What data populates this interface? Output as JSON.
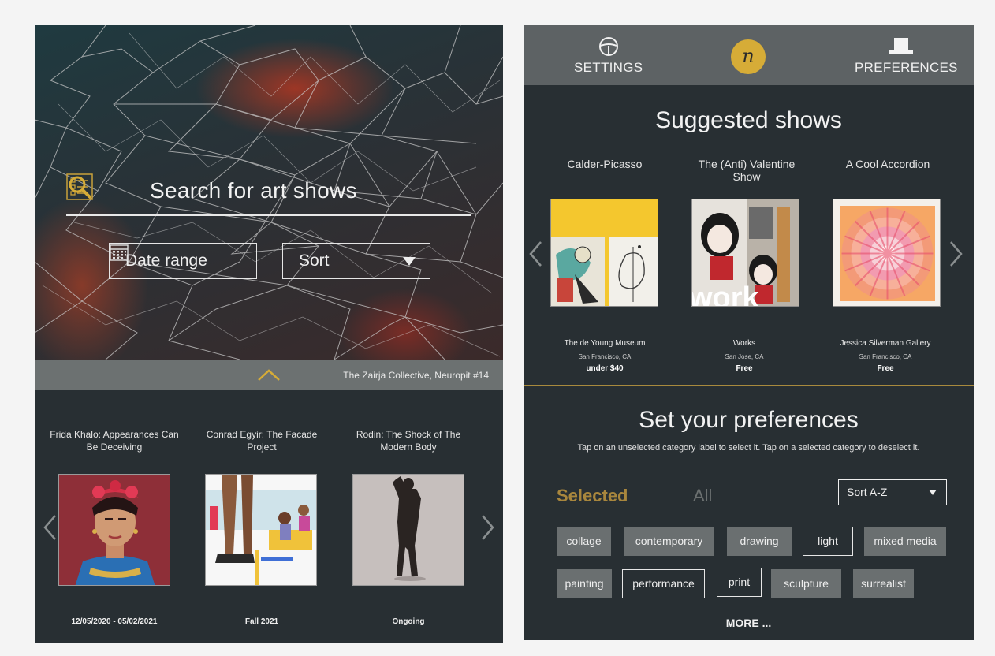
{
  "left": {
    "search": {
      "placeholder": "Search for art shows"
    },
    "filters": {
      "date_range": "Date range",
      "sort": "Sort"
    },
    "credit": "The Zairja Collective, Neuropit #14",
    "shows": [
      {
        "title": "Frida Khalo:   Appearances Can Be Deceiving",
        "date": "12/05/2020 - 05/02/2021"
      },
      {
        "title": "Conrad Egyir: The Facade Project",
        "date": "Fall 2021"
      },
      {
        "title": "Rodin: The Shock of The Modern Body",
        "date": "Ongoing"
      }
    ]
  },
  "right": {
    "nav": {
      "settings": "SETTINGS",
      "logo": "n",
      "preferences": "PREFERENCES"
    },
    "suggested_title": "Suggested shows",
    "suggested": [
      {
        "title": "Calder-Picasso",
        "venue": "The de Young Museum",
        "city": "San Francisco, CA",
        "price": "under $40"
      },
      {
        "title": "The (Anti) Valentine Show",
        "venue": "Works",
        "city": "San Jose, CA",
        "price": "Free"
      },
      {
        "title": "A Cool Accordion",
        "venue": "Jessica Silverman Gallery",
        "city": "San Francisco, CA",
        "price": "Free"
      }
    ],
    "thumb_text": "work",
    "pref_title": "Set your preferences",
    "pref_sub": "Tap on an unselected category label to select it. Tap on a selected category to deselect it.",
    "tabs": {
      "selected": "Selected",
      "all": "All"
    },
    "sort_az": "Sort A-Z",
    "tags": [
      {
        "label": "collage",
        "selected": true
      },
      {
        "label": "contemporary",
        "selected": true
      },
      {
        "label": "drawing",
        "selected": true
      },
      {
        "label": "light",
        "selected": false
      },
      {
        "label": "mixed media",
        "selected": true
      },
      {
        "label": "painting",
        "selected": true
      },
      {
        "label": "performance",
        "selected": false
      },
      {
        "label": "print",
        "selected": false
      },
      {
        "label": "sculpture",
        "selected": true
      },
      {
        "label": "surrealist",
        "selected": true
      }
    ],
    "more": "MORE ..."
  },
  "colors": {
    "gold": "#d6ac37",
    "accent_text": "#a8863d",
    "panel_bg": "#282f33",
    "tag_selected_bg": "#6a6f70"
  }
}
